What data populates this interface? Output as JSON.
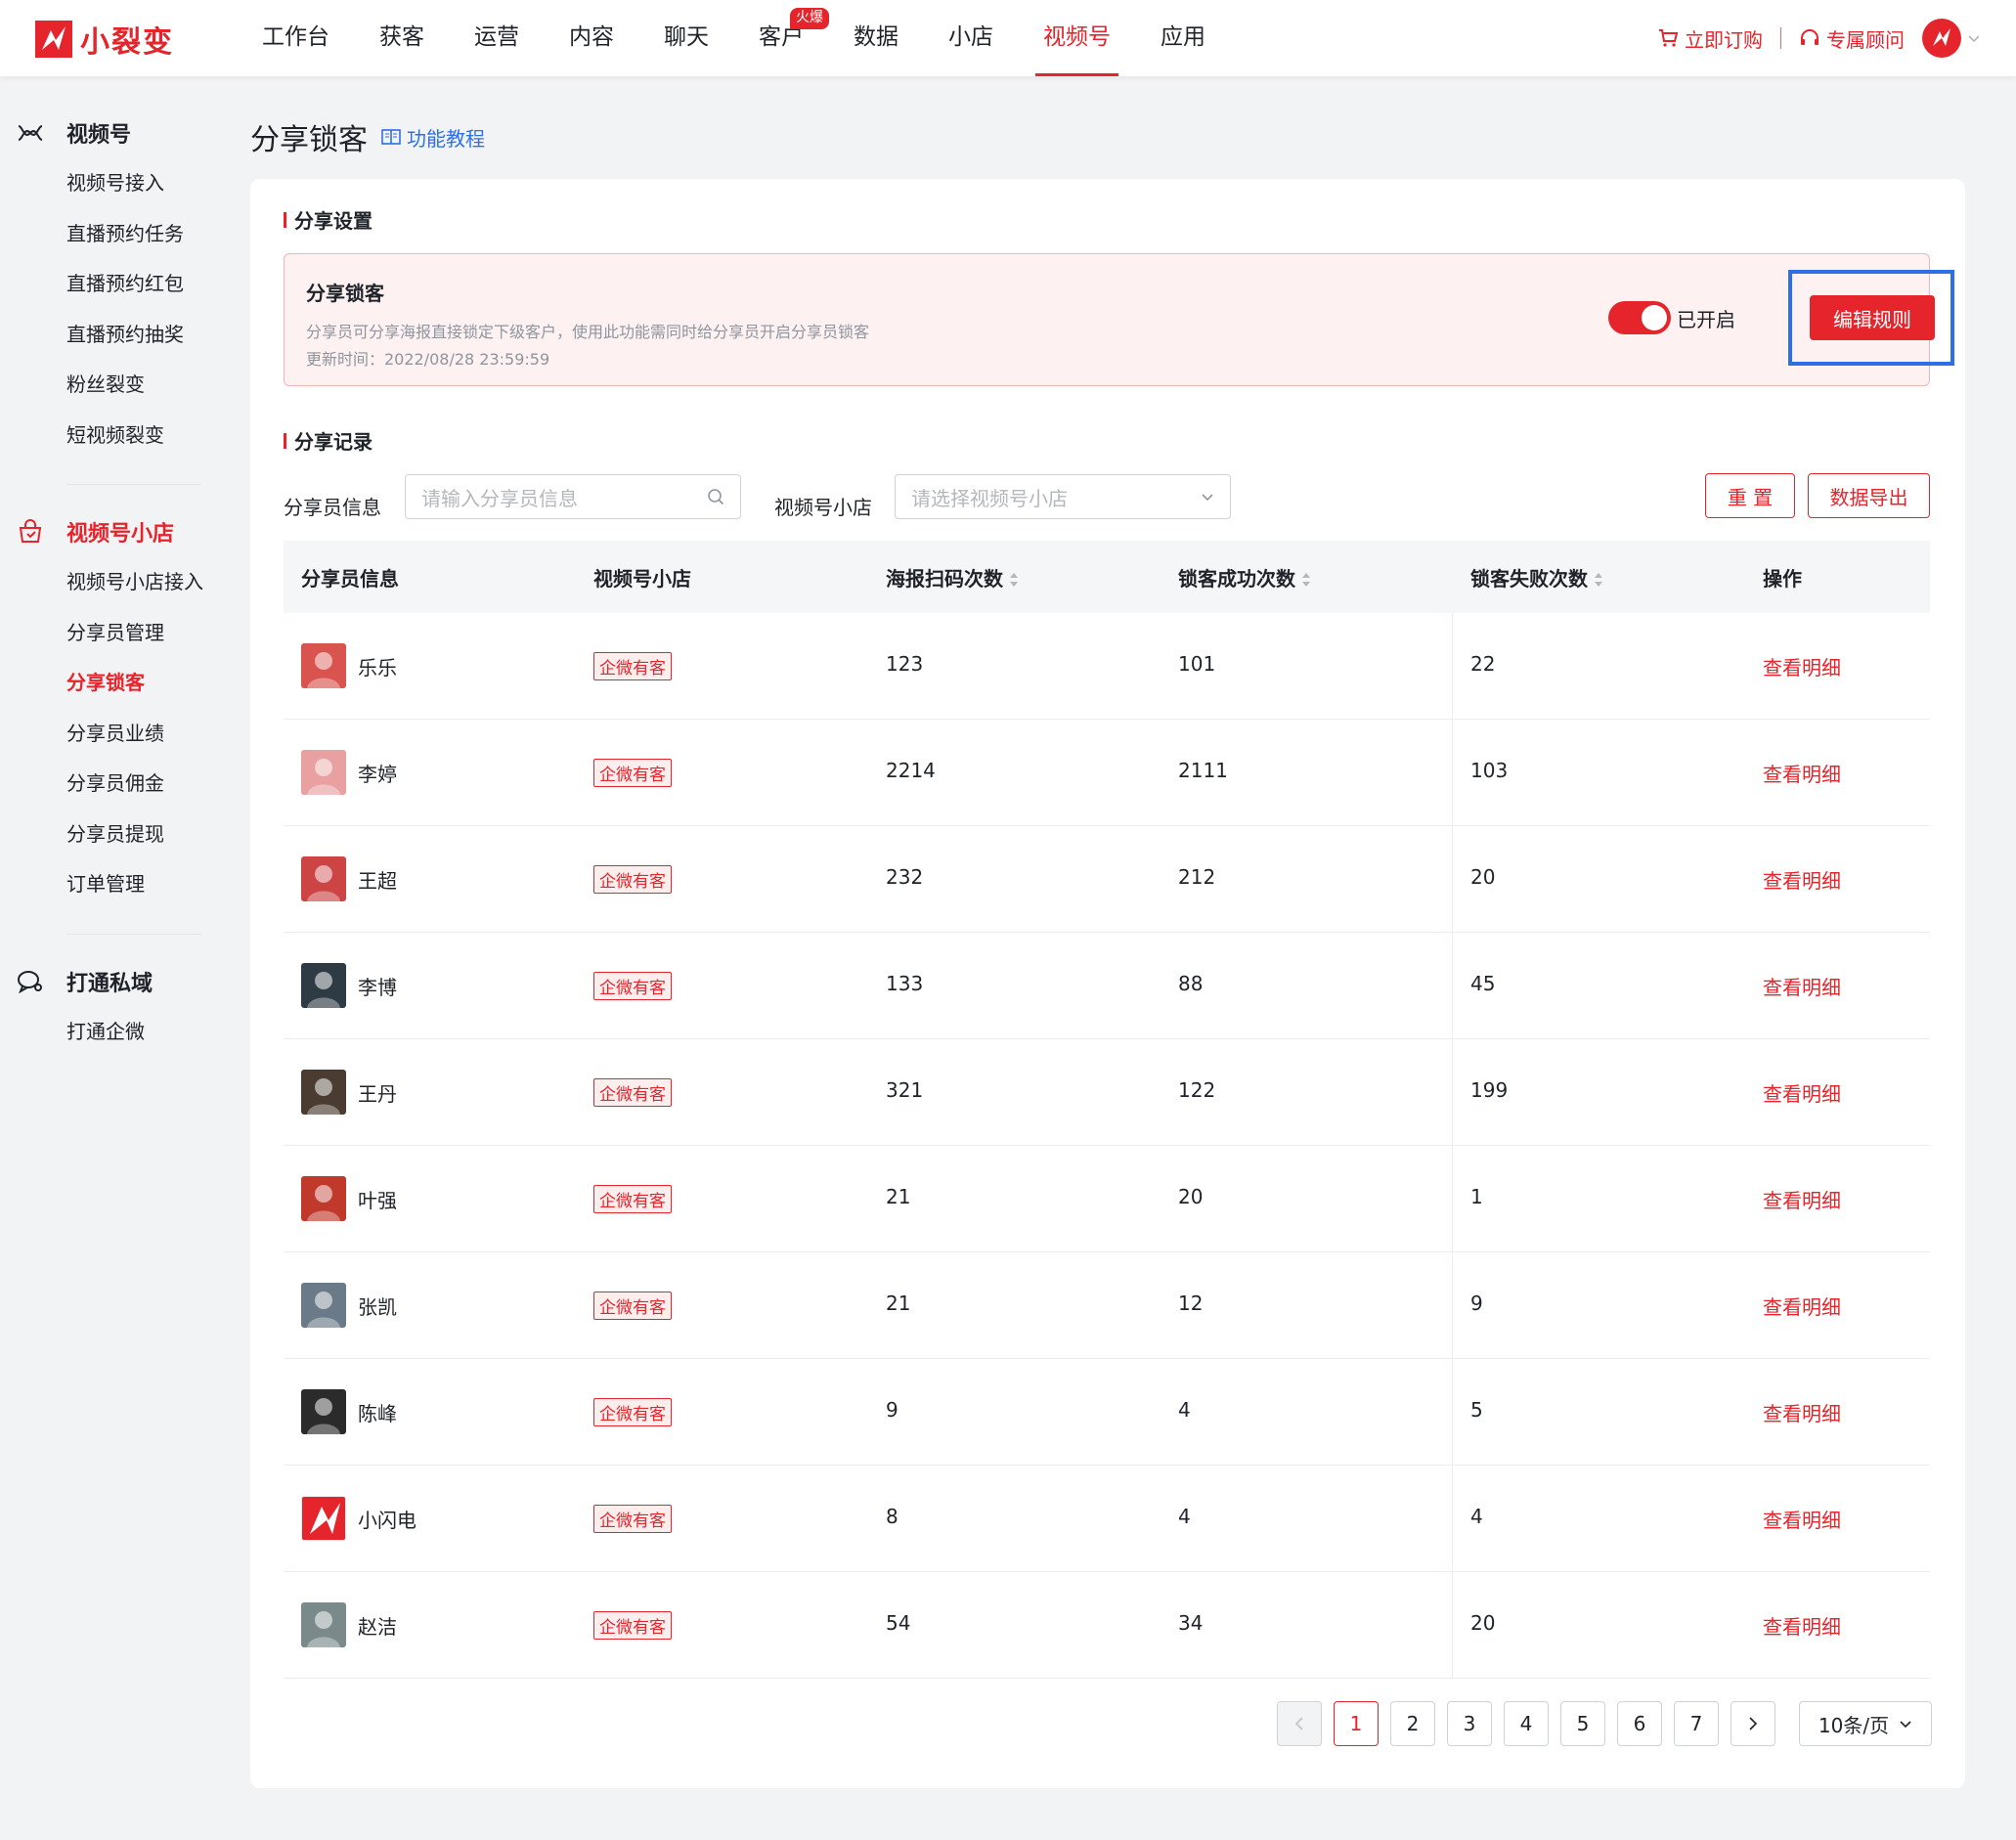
{
  "brand": {
    "name": "小裂变",
    "color": "#e5242b"
  },
  "nav": {
    "items": [
      {
        "label": "工作台"
      },
      {
        "label": "获客"
      },
      {
        "label": "运营"
      },
      {
        "label": "内容"
      },
      {
        "label": "聊天"
      },
      {
        "label": "客户",
        "badge": "火爆"
      },
      {
        "label": "数据"
      },
      {
        "label": "小店"
      },
      {
        "label": "视频号",
        "active": true
      },
      {
        "label": "应用"
      }
    ],
    "buy_label": "立即订购",
    "consultant_label": "专属顾问"
  },
  "sidebar": {
    "groups": [
      {
        "title": "视频号",
        "icon": "video-channel-icon",
        "items": [
          "视频号接入",
          "直播预约任务",
          "直播预约红包",
          "直播预约抽奖",
          "粉丝裂变",
          "短视频裂变"
        ]
      },
      {
        "title": "视频号小店",
        "icon": "shop-icon",
        "items": [
          "视频号小店接入",
          "分享员管理",
          "分享锁客",
          "分享员业绩",
          "分享员佣金",
          "分享员提现",
          "订单管理"
        ]
      },
      {
        "title": "打通私域",
        "icon": "chat-icon",
        "items": [
          "打通企微"
        ]
      }
    ],
    "active_item": "分享锁客"
  },
  "page": {
    "title": "分享锁客",
    "tutorial_label": "功能教程"
  },
  "settings": {
    "section_title": "分享设置",
    "box_title": "分享锁客",
    "description": "分享员可分享海报直接锁定下级客户，使用此功能需同时给分享员开启分享员锁客",
    "updated": "更新时间：2022/08/28 23:59:59",
    "toggle_label": "已开启",
    "toggle_on": true,
    "edit_label": "编辑规则"
  },
  "records": {
    "section_title": "分享记录",
    "filter_sharer_label": "分享员信息",
    "filter_sharer_placeholder": "请输入分享员信息",
    "filter_shop_label": "视频号小店",
    "filter_shop_placeholder": "请选择视频号小店",
    "reset_label": "重 置",
    "export_label": "数据导出",
    "columns": [
      "分享员信息",
      "视频号小店",
      "海报扫码次数",
      "锁客成功次数",
      "锁客失败次数",
      "操作"
    ],
    "rows": [
      {
        "name": "乐乐",
        "shop": "企微有客",
        "scans": "123",
        "success": "101",
        "fail": "22",
        "action": "查看明细"
      },
      {
        "name": "李婷",
        "shop": "企微有客",
        "scans": "2214",
        "success": "2111",
        "fail": "103",
        "action": "查看明细"
      },
      {
        "name": "王超",
        "shop": "企微有客",
        "scans": "232",
        "success": "212",
        "fail": "20",
        "action": "查看明细"
      },
      {
        "name": "李博",
        "shop": "企微有客",
        "scans": "133",
        "success": "88",
        "fail": "45",
        "action": "查看明细"
      },
      {
        "name": "王丹",
        "shop": "企微有客",
        "scans": "321",
        "success": "122",
        "fail": "199",
        "action": "查看明细"
      },
      {
        "name": "叶强",
        "shop": "企微有客",
        "scans": "21",
        "success": "20",
        "fail": "1",
        "action": "查看明细"
      },
      {
        "name": "张凯",
        "shop": "企微有客",
        "scans": "21",
        "success": "12",
        "fail": "9",
        "action": "查看明细"
      },
      {
        "name": "陈峰",
        "shop": "企微有客",
        "scans": "9",
        "success": "4",
        "fail": "5",
        "action": "查看明细"
      },
      {
        "name": "小闪电",
        "shop": "企微有客",
        "scans": "8",
        "success": "4",
        "fail": "4",
        "action": "查看明细"
      },
      {
        "name": "赵洁",
        "shop": "企微有客",
        "scans": "54",
        "success": "34",
        "fail": "20",
        "action": "查看明细"
      }
    ]
  },
  "pagination": {
    "pages": [
      "1",
      "2",
      "3",
      "4",
      "5",
      "6",
      "7"
    ],
    "current": "1",
    "page_size_label": "10条/页"
  }
}
